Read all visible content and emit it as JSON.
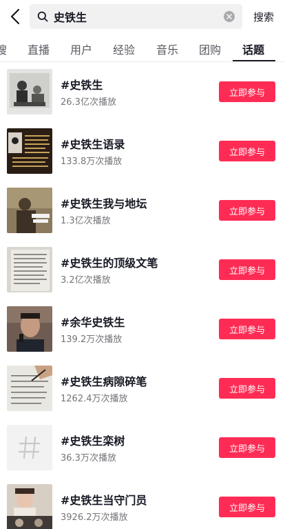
{
  "search": {
    "query": "史铁生",
    "submit_label": "搜索"
  },
  "tabs": [
    {
      "label": "搜"
    },
    {
      "label": "直播"
    },
    {
      "label": "用户"
    },
    {
      "label": "经验"
    },
    {
      "label": "音乐"
    },
    {
      "label": "团购"
    },
    {
      "label": "话题"
    }
  ],
  "active_tab": "话题",
  "colors": {
    "accent": "#fe2c55",
    "text": "#161823",
    "muted": "#737478"
  },
  "topics": [
    {
      "title": "#史铁生",
      "plays": "26.3亿次播放",
      "button": "立即参与",
      "thumb": "photo-two-people"
    },
    {
      "title": "#史铁生语录",
      "plays": "133.8万次播放",
      "button": "立即参与",
      "thumb": "photo-quote-text"
    },
    {
      "title": "#史铁生我与地坛",
      "plays": "1.3亿次播放",
      "button": "立即参与",
      "thumb": "photo-sepia-portrait"
    },
    {
      "title": "#史铁生的顶级文笔",
      "plays": "3.2亿次播放",
      "button": "立即参与",
      "thumb": "photo-book-page"
    },
    {
      "title": "#余华史铁生",
      "plays": "139.2万次播放",
      "button": "立即参与",
      "thumb": "photo-man-with-mic"
    },
    {
      "title": "#史铁生病隙碎笔",
      "plays": "1262.4万次播放",
      "button": "立即参与",
      "thumb": "photo-handwriting"
    },
    {
      "title": "#史铁生栾树",
      "plays": "36.3万次播放",
      "button": "立即参与",
      "thumb": "hashtag-placeholder-icon"
    },
    {
      "title": "#史铁生当守门员",
      "plays": "3926.2万次播放",
      "button": "立即参与",
      "thumb": "photo-woman-collage"
    }
  ]
}
